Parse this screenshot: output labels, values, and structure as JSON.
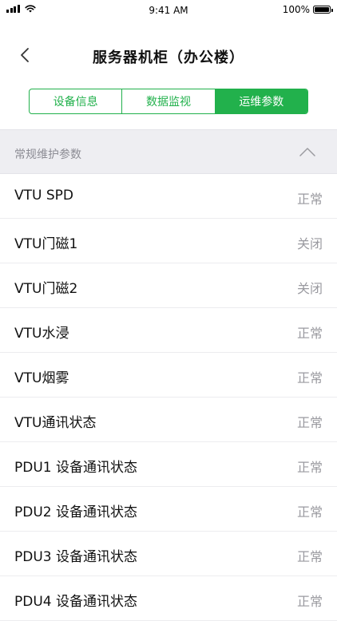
{
  "status_bar": {
    "time": "9:41 AM",
    "battery": "100%"
  },
  "nav": {
    "title": "服务器机柜（办公楼）",
    "back_icon": "chevron-left-icon"
  },
  "tabs": [
    {
      "label": "设备信息",
      "active": false
    },
    {
      "label": "数据监视",
      "active": false
    },
    {
      "label": "运维参数",
      "active": true
    }
  ],
  "colors": {
    "accent": "#22b14c",
    "section_bg": "#eeeef2",
    "value_text": "#9a9aa0"
  },
  "section": {
    "title": "常规维护参数",
    "toggle_icon": "chevron-up-icon"
  },
  "rows": [
    {
      "label": "VTU SPD",
      "value": "正常"
    },
    {
      "label": "VTU门磁1",
      "value": "关闭"
    },
    {
      "label": "VTU门磁2",
      "value": "关闭"
    },
    {
      "label": "VTU水浸",
      "value": "正常"
    },
    {
      "label": "VTU烟雾",
      "value": "正常"
    },
    {
      "label": "VTU通讯状态",
      "value": "正常"
    },
    {
      "label": "PDU1 设备通讯状态",
      "value": "正常"
    },
    {
      "label": "PDU2 设备通讯状态",
      "value": "正常"
    },
    {
      "label": "PDU3 设备通讯状态",
      "value": "正常"
    },
    {
      "label": "PDU4 设备通讯状态",
      "value": "正常"
    }
  ]
}
